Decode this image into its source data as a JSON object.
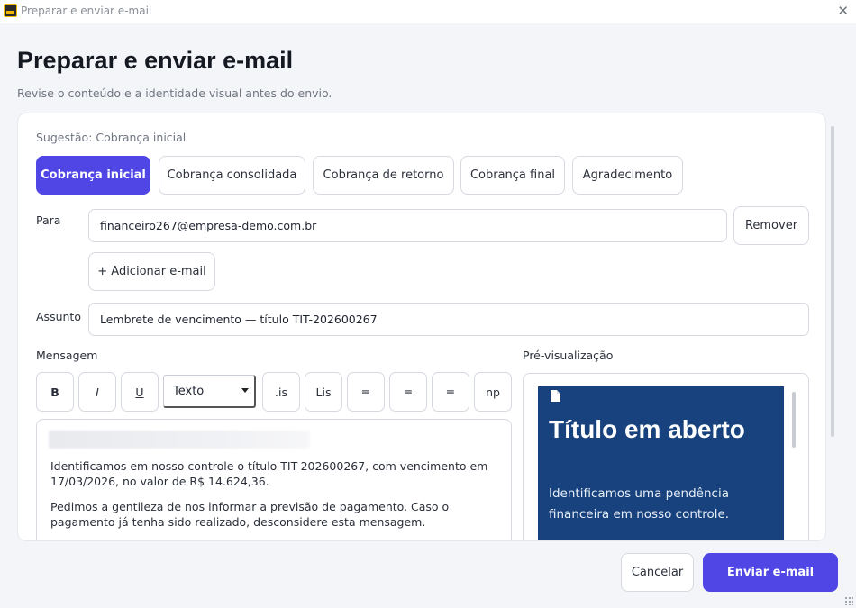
{
  "window": {
    "title": "Preparar e enviar e-mail",
    "close_icon": "close-icon"
  },
  "page": {
    "title": "Preparar e enviar e-mail",
    "subtitle": "Revise o conteúdo e a identidade visual antes do envio."
  },
  "suggestion": "Sugestão: Cobrança inicial",
  "tabs": [
    {
      "label": "Cobrança inicial",
      "active": true
    },
    {
      "label": "Cobrança consolidada",
      "active": false
    },
    {
      "label": "Cobrança de retorno",
      "active": false
    },
    {
      "label": "Cobrança final",
      "active": false
    },
    {
      "label": "Agradecimento",
      "active": false
    }
  ],
  "to": {
    "label": "Para",
    "value": "financeiro267@empresa-demo.com.br",
    "remove_label": "Remover",
    "add_label": "+ Adicionar e-mail"
  },
  "subject": {
    "label": "Assunto",
    "value": "Lembrete de vencimento — título TIT-202600267"
  },
  "message": {
    "label": "Mensagem",
    "toolbar": {
      "bold": "B",
      "italic": "I",
      "underline": "U",
      "format_select": "Texto",
      "t1": ".is",
      "t2": "Lis",
      "t3": "≡",
      "t4": "≡",
      "t5": "≡",
      "t6": "np"
    },
    "paragraphs": [
      "Identificamos em nosso controle o título TIT-202600267, com vencimento em 17/03/2026, no valor de R$ 14.624,36.",
      "Pedimos a gentileza de nos informar a previsão de pagamento. Caso o pagamento já tenha sido realizado, desconsidere esta mensagem."
    ]
  },
  "preview": {
    "label": "Pré-visualização",
    "hero_title": "Título em aberto",
    "hero_text": "Identificamos uma pendência financeira em nosso controle.",
    "hero_color": "#17427d"
  },
  "footer": {
    "cancel": "Cancelar",
    "send": "Enviar e-mail"
  },
  "colors": {
    "accent": "#4f46e5"
  }
}
